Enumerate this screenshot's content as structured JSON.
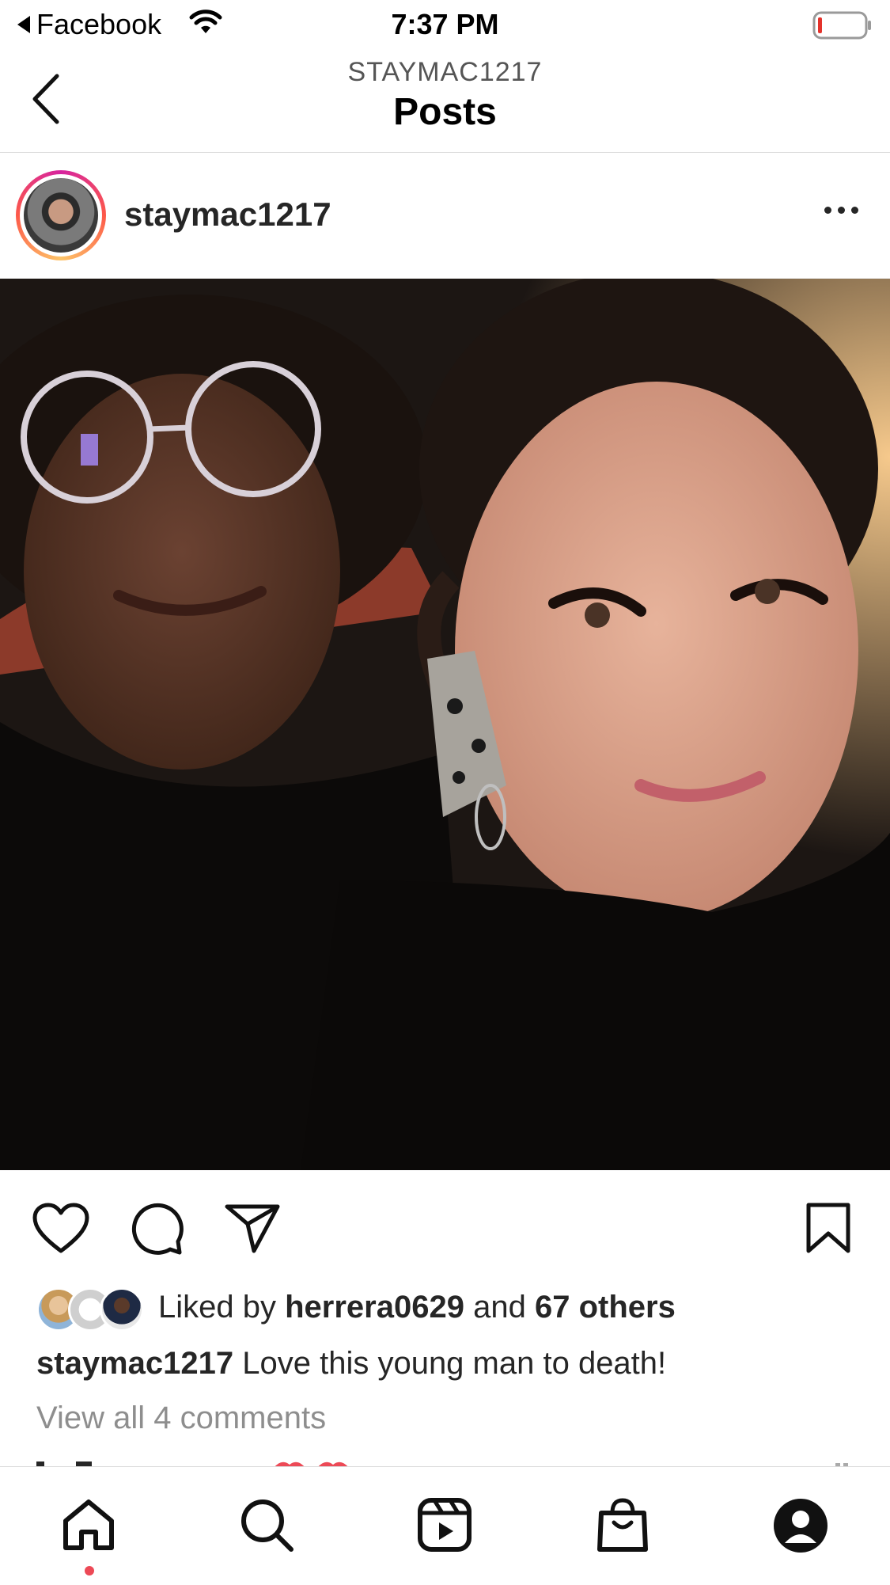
{
  "status_bar": {
    "back_app_label": "Facebook",
    "time": "7:37 PM",
    "battery_level": 0.08
  },
  "header": {
    "account": "STAYMAC1217",
    "title": "Posts"
  },
  "post": {
    "username": "staymac1217",
    "likes": {
      "prefix": "Liked by",
      "top_liker": "herrera0629",
      "joiner": "and",
      "others": "67 others"
    },
    "caption": {
      "username": "staymac1217",
      "text": "Love this young man to death!"
    },
    "view_comments": "View all 4 comments"
  },
  "icons": {
    "back": "chevron-left-icon",
    "more": "more-horizontal-icon",
    "like": "heart-icon",
    "comment": "comment-icon",
    "share": "paper-plane-icon",
    "save": "bookmark-icon"
  },
  "tabs": [
    "home",
    "search",
    "reels",
    "shop",
    "profile"
  ],
  "colors": {
    "accent_red": "#ed4956",
    "secondary_text": "#8e8e8e",
    "divider": "#dbdbdb"
  }
}
